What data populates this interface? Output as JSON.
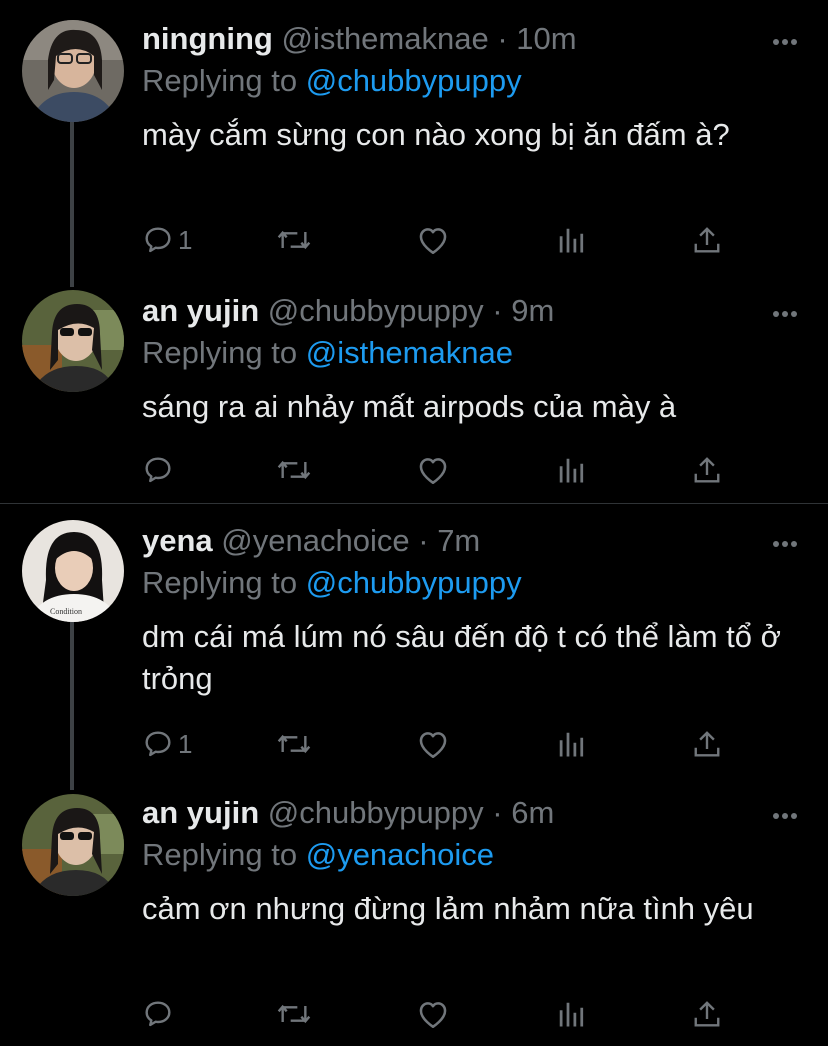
{
  "tweets": [
    {
      "name": "ningning",
      "handle": "@isthemaknae",
      "separator": "·",
      "time": "10m",
      "replying_prefix": "Replying to",
      "replying_to": "@chubbypuppy",
      "text": "mày cắm sừng con nào xong bị ăn đấm à?",
      "reply_count": "1"
    },
    {
      "name": "an yujin",
      "handle": "@chubbypuppy",
      "separator": "·",
      "time": "9m",
      "replying_prefix": "Replying to",
      "replying_to": "@isthemaknae",
      "text": "sáng ra ai nhảy mất airpods của mày à",
      "reply_count": ""
    },
    {
      "name": "yena",
      "handle": "@yenachoice",
      "separator": "·",
      "time": "7m",
      "replying_prefix": "Replying to",
      "replying_to": "@chubbypuppy",
      "text": "dm cái má lúm nó sâu đến độ t có thể làm tổ ở trỏng",
      "reply_count": "1"
    },
    {
      "name": "an yujin",
      "handle": "@chubbypuppy",
      "separator": "·",
      "time": "6m",
      "replying_prefix": "Replying to",
      "replying_to": "@yenachoice",
      "text": "cảm ơn nhưng đừng lảm nhảm nữa tình yêu",
      "reply_count": ""
    }
  ],
  "colors": {
    "background": "#000000",
    "text": "#e7e9ea",
    "muted": "#71767b",
    "accent": "#1d9bf0",
    "thread_line": "#3d4145"
  },
  "icons": {
    "more": "more-dots-icon",
    "reply": "reply-bubble-icon",
    "retweet": "retweet-icon",
    "like": "heart-icon",
    "analytics": "analytics-bars-icon",
    "share": "share-upload-icon"
  }
}
